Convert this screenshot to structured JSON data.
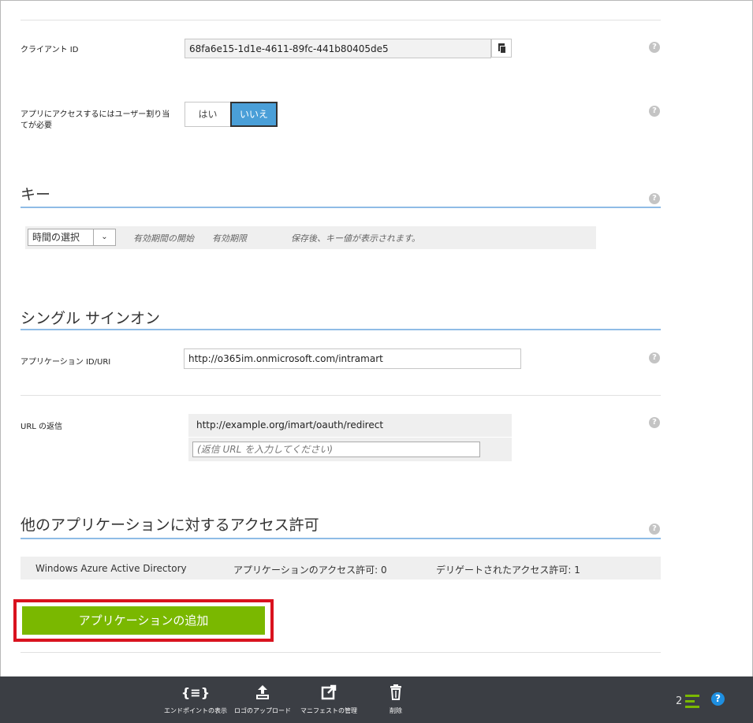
{
  "client_id": {
    "label": "クライアント ID",
    "value": "68fa6e15-1d1e-4611-89fc-441b80405de5"
  },
  "user_assignment": {
    "label_line1": "アプリにアクセスするにはユーザー割り当",
    "label_line2": "てが必要",
    "yes_label": "はい",
    "no_label": "いいえ",
    "selected": "いいえ"
  },
  "keys": {
    "title": "キー",
    "duration_select": "時間の選択",
    "start_label": "有効期間の開始",
    "expire_label": "有効期限",
    "note": "保存後、キー値が表示されます。"
  },
  "sso": {
    "title": "シングル サインオン",
    "app_id_label": "アプリケーション ID/URI",
    "app_id_value": "http://o365im.onmicrosoft.com/intramart",
    "reply_url_label": "URL の返信",
    "reply_url_value": "http://example.org/imart/oauth/redirect",
    "reply_url_placeholder": "(返信 URL を入力してください)"
  },
  "permissions": {
    "title": "他のアプリケーションに対するアクセス許可",
    "app_name": "Windows Azure Active Directory",
    "app_permissions": "アプリケーションのアクセス許可: 0",
    "delegated_permissions": "デリゲートされたアクセス許可: 1",
    "add_button": "アプリケーションの追加"
  },
  "help_icon": "?",
  "footer": {
    "endpoints": "エンドポイントの表示",
    "upload_logo": "ロゴのアップロード",
    "manage_manifest": "マニフェストの管理",
    "delete": "削除",
    "count": "2",
    "help": "?"
  },
  "colors": {
    "accent_blue": "#4a9fd8",
    "add_green": "#7ab800",
    "highlight_red": "#d9121e",
    "footer_bg": "#3b3e44"
  }
}
